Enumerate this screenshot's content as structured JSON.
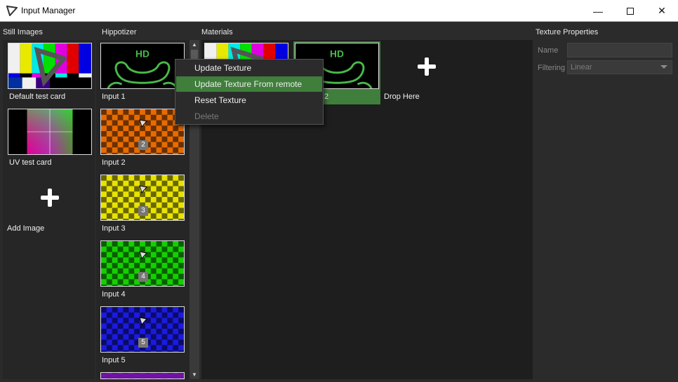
{
  "window": {
    "title": "Input Manager",
    "icon": "hippo-logo-icon"
  },
  "sections": {
    "still_images": "Still Images",
    "hippotizer": "Hippotizer",
    "materials": "Materials",
    "texture_properties": "Texture Properties"
  },
  "still_images": {
    "items": [
      {
        "label": "Default test card"
      },
      {
        "label": "UV test card"
      }
    ],
    "add_label": "Add Image"
  },
  "hippotizer": {
    "items": [
      {
        "label": "Input 1",
        "badge": "",
        "color": "#000000"
      },
      {
        "label": "Input 2",
        "badge": "2",
        "color": "#e86b00"
      },
      {
        "label": "Input 3",
        "badge": "3",
        "color": "#e8e400"
      },
      {
        "label": "Input 4",
        "badge": "4",
        "color": "#14d000"
      },
      {
        "label": "Input 5",
        "badge": "5",
        "color": "#1a1ae0"
      }
    ],
    "partial_item_color": "#9a1ae0"
  },
  "materials": {
    "items": [
      {
        "label": ""
      },
      {
        "label": "2",
        "selected": true
      }
    ],
    "drop_label": "Drop Here"
  },
  "context_menu": {
    "items": [
      {
        "label": "Update Texture",
        "enabled": true
      },
      {
        "label": "Update Texture From remote",
        "enabled": true,
        "highlighted": true
      },
      {
        "label": "Reset Texture",
        "enabled": true
      },
      {
        "label": "Delete",
        "enabled": false
      }
    ]
  },
  "texture_properties": {
    "name_label": "Name",
    "name_value": "",
    "filtering_label": "Filtering",
    "filtering_value": "Linear"
  },
  "colors": {
    "accent_selected": "#3f7e3b",
    "hd_logo_green": "#4ab84a"
  }
}
